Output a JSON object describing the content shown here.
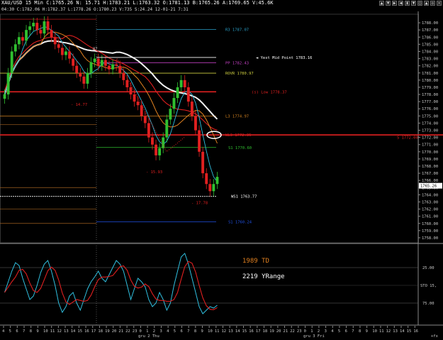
{
  "header": {
    "title_line": "XAU/USD 15 Min C:1765.26 N: 15.71 H:1783.21 L:1763.32 O:1781.13 B:1765.26 A:1769.65 V:45.6K",
    "sub_line": "04:30 C:1782.06 H:1782.37 L:1778.26 O:1780.23 V:735 S:24.24 12-01-21 7:31",
    "buttons": [
      "▲",
      "▼",
      "▶",
      "◀",
      "▮",
      "▼",
      "○",
      "▲",
      "◇",
      "✕"
    ]
  },
  "price_axis": {
    "ticks": [
      "1788.00",
      "1787.00",
      "1786.00",
      "1785.00",
      "1784.00",
      "1783.00",
      "1782.00",
      "1781.00",
      "1780.00",
      "1779.00",
      "1778.00",
      "1777.00",
      "1776.00",
      "1775.00",
      "1774.00",
      "1773.00",
      "1772.00",
      "1771.00",
      "1770.00",
      "1769.00",
      "1768.00",
      "1767.00",
      "1766.00",
      "1765.00",
      "1764.00",
      "1763.00",
      "1762.00",
      "1761.00",
      "1760.00",
      "1759.00",
      "1758.00"
    ],
    "last_price": "1765.26"
  },
  "levels": [
    {
      "label": "R3 1787.07",
      "color": "#2aa0c8"
    },
    {
      "label": "PP 1782.43",
      "color": "#c040c0"
    },
    {
      "label": "ROVR 1780.97",
      "color": "#d0d040"
    },
    {
      "label": "(s) Low 1778.37",
      "color": "#e02020"
    },
    {
      "label": "L3 1774.97",
      "color": "#d08020"
    },
    {
      "label": "WL3 1772.35",
      "color": "#e02020"
    },
    {
      "label": "S1 1770.60",
      "color": "#30c030"
    },
    {
      "label": "WS1 1763.77",
      "color": "#ffffff"
    },
    {
      "label": "S1 1760.24",
      "color": "#2050e0"
    }
  ],
  "annotations": {
    "yest_mid": "Yest Mid Point 1783.16",
    "right_edge": "S 1772.00",
    "ann1": "- 14.77",
    "ann2": "- 15.93",
    "ann3": "- 17.78",
    "ann4": "87"
  },
  "oscillator": {
    "td_text": "1989 TD",
    "range_text": "2219 YRange",
    "ticks": [
      "25.00",
      "STO 15,",
      "75.00"
    ],
    "colors": {
      "td": "#e08020",
      "range": "#ffffff"
    }
  },
  "time_axis": {
    "labels": [
      "4",
      "5",
      "6",
      "7",
      "8",
      "9",
      "10",
      "11",
      "12",
      "13",
      "14",
      "15",
      "16",
      "17",
      "18",
      "19",
      "20",
      "21",
      "22",
      "23",
      "0",
      "1",
      "2",
      "3",
      "4",
      "5",
      "6",
      "7",
      "8",
      "9",
      "10",
      "11",
      "12",
      "13",
      "14",
      "15",
      "16",
      "17",
      "18",
      "19",
      "20",
      "21",
      "22",
      "23",
      "0",
      "1",
      "2",
      "3",
      "4",
      "5",
      "6",
      "7",
      "8",
      "9",
      "10",
      "11",
      "12",
      "13",
      "14",
      "15",
      "16"
    ],
    "day_labels": [
      "gru 2 Thu",
      "gru 3 Fri"
    ],
    "corner": "+fx"
  },
  "colors": {
    "background": "#000000",
    "axis": "#808080",
    "candle_up": "#30c030",
    "candle_down": "#e02020",
    "ma_white": "#f0f0f0",
    "ma_red": "#e02020",
    "ma_orange": "#e08020",
    "ma_cyan": "#30c0e0",
    "stoch_fast": "#30c0e0",
    "stoch_slow": "#e02020"
  }
}
